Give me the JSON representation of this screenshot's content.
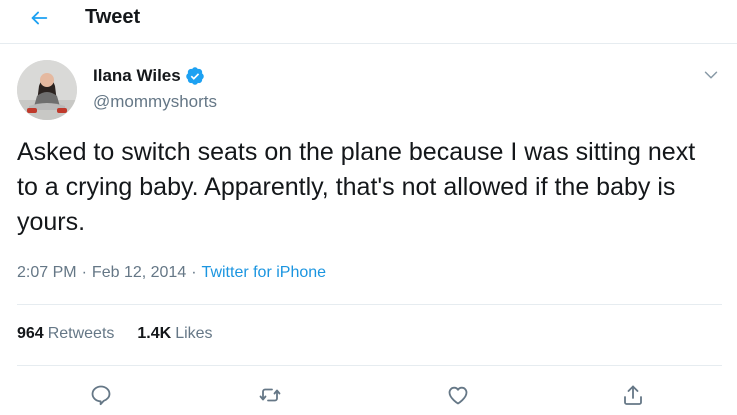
{
  "header": {
    "title": "Tweet",
    "back_icon": "arrow-left-icon"
  },
  "tweet": {
    "author": {
      "name": "Ilana Wiles",
      "handle": "@mommyshorts",
      "verified": true,
      "avatar_icon": "avatar-photo"
    },
    "text": "Asked to switch seats on the plane because I was sitting next to a crying baby. Apparently, that's not allowed if the baby is yours.",
    "time": "2:07 PM",
    "date": "Feb 12, 2014",
    "separator": "·",
    "client": "Twitter for iPhone"
  },
  "stats": {
    "retweets_count": "964",
    "retweets_label": "Retweets",
    "likes_count": "1.4K",
    "likes_label": "Likes"
  },
  "actions": [
    "reply-icon",
    "retweet-icon",
    "like-icon",
    "share-icon"
  ],
  "colors": {
    "accent": "#1da1f2",
    "link": "#1b95e0",
    "secondary_text": "#657786",
    "primary_text": "#14171a",
    "divider": "#e6ecf0"
  }
}
